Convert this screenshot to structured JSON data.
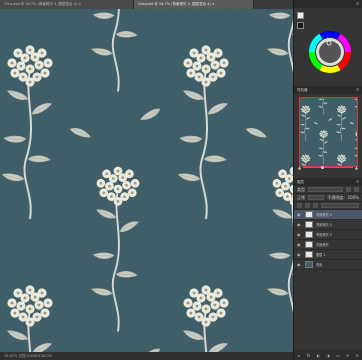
{
  "tabs": [
    {
      "label": "CH-s.psd @ 16.7% (背景拷贝 4, 图层混合 4) ×"
    },
    {
      "label": "Unsaved @ 16.7% (背景拷贝 4, 图层混合 4) ×"
    }
  ],
  "status": {
    "text": "16.67%   文档:3.00M/126.0M"
  },
  "colors": {
    "bg": "#3f5e68",
    "flower": "#ece9dc",
    "leaf": "#c9ccc2",
    "stem": "#d6d7cf",
    "accent": "#d33333"
  },
  "color_panel": {
    "menu_icon": "hamburger-icon"
  },
  "navigator": {
    "title": "导航器",
    "zoom": "16.67%"
  },
  "layers": {
    "tab_label": "图层",
    "kind_label": "类型",
    "blend_label": "正常",
    "opacity_label": "不透明度:",
    "opacity_value": "100%",
    "items": [
      {
        "name": "背景拷贝 4",
        "selected": true
      },
      {
        "name": "背景拷贝 3",
        "selected": false
      },
      {
        "name": "背景拷贝 2",
        "selected": false
      },
      {
        "name": "背景拷贝",
        "selected": false
      },
      {
        "name": "图层 1",
        "selected": false
      },
      {
        "name": "背景",
        "selected": false
      }
    ]
  }
}
